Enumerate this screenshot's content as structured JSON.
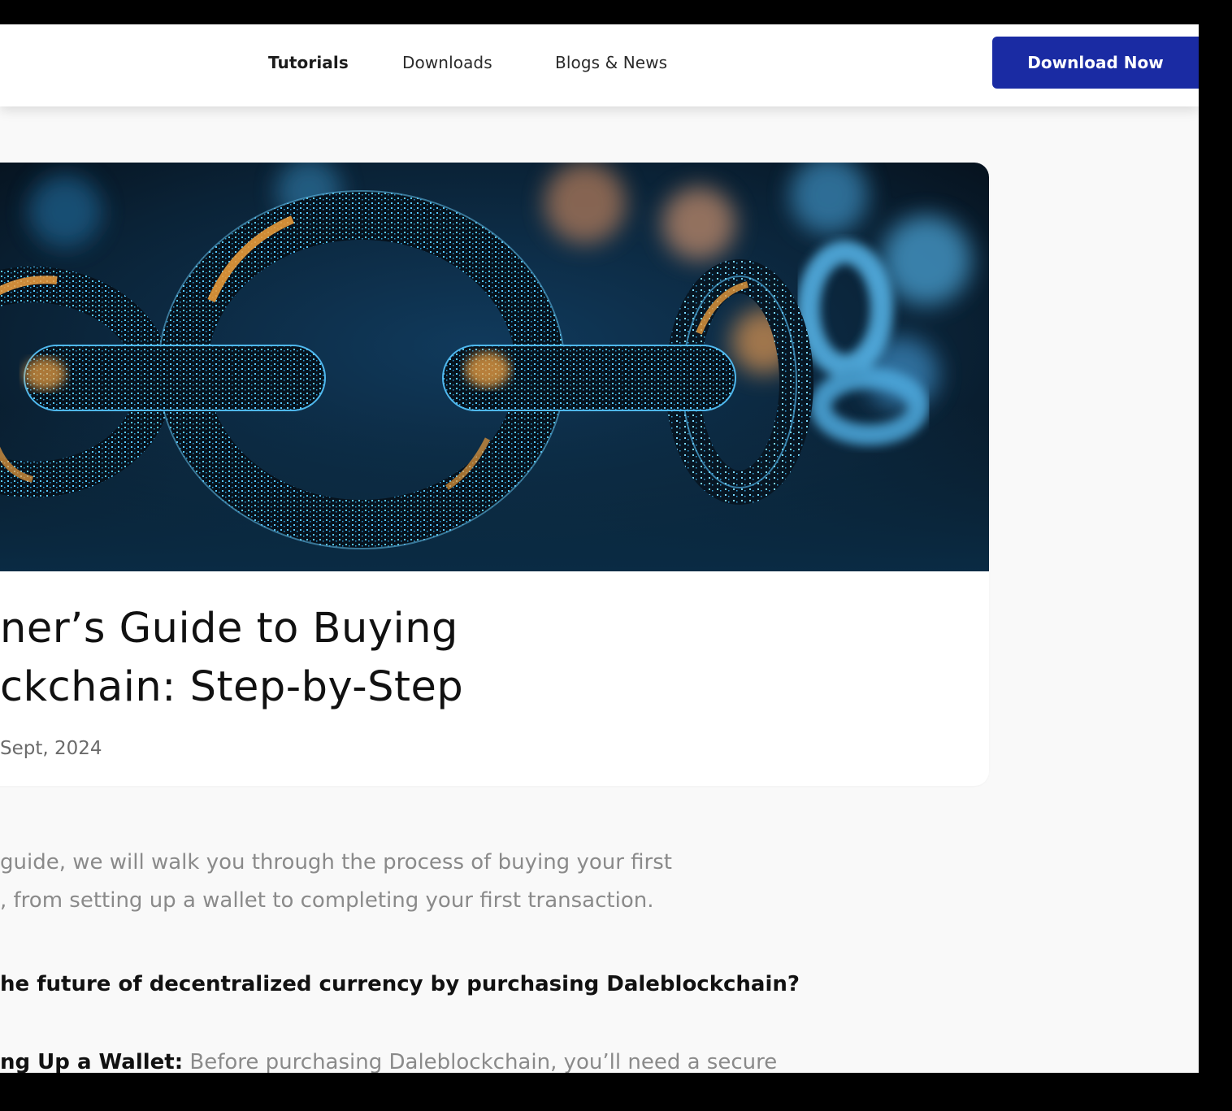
{
  "nav": {
    "links": [
      "Tutorials",
      "Downloads",
      "Blogs & News"
    ],
    "cta_label": "Download Now"
  },
  "article": {
    "hero_alt": "Glowing digital chain links",
    "title_line1": "ner’s Guide to Buying",
    "title_line2": "ckchain: Step-by-Step",
    "date": "Sept, 2024",
    "lead_line1": "guide, we will walk you through the process of buying your first",
    "lead_line2": ", from setting up a wallet to completing your first transaction.",
    "question": "he future of decentralized currency by purchasing Daleblockchain?",
    "step1_label": "ng Up a Wallet:",
    "step1_text": " Before purchasing Daleblockchain, you’ll need a secure"
  },
  "colors": {
    "primary": "#1a2ba3",
    "page_bg": "#f9f9f9"
  }
}
